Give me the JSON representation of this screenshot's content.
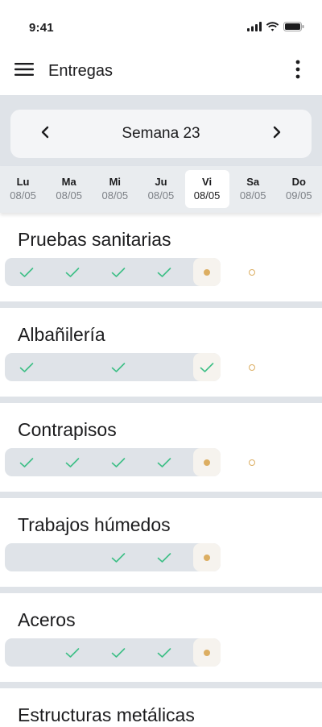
{
  "status": {
    "time": "9:41"
  },
  "appbar": {
    "title": "Entregas"
  },
  "week": {
    "label": "Semana 23"
  },
  "days": [
    {
      "name": "Lu",
      "date": "08/05",
      "active": false
    },
    {
      "name": "Ma",
      "date": "08/05",
      "active": false
    },
    {
      "name": "Mi",
      "date": "08/05",
      "active": false
    },
    {
      "name": "Ju",
      "date": "08/05",
      "active": false
    },
    {
      "name": "Vi",
      "date": "08/05",
      "active": true
    },
    {
      "name": "Sa",
      "date": "08/05",
      "active": false
    },
    {
      "name": "Do",
      "date": "09/05",
      "active": false
    }
  ],
  "sections": [
    {
      "title": "Pruebas sanitarias",
      "checks": [
        true,
        true,
        true,
        true
      ],
      "today": "dot",
      "pending": true
    },
    {
      "title": "Albañilería",
      "checks": [
        true,
        false,
        true,
        false
      ],
      "today": "check",
      "pending": true
    },
    {
      "title": "Contrapisos",
      "checks": [
        true,
        true,
        true,
        true
      ],
      "today": "dot",
      "pending": true
    },
    {
      "title": "Trabajos húmedos",
      "checks": [
        false,
        false,
        true,
        true
      ],
      "today": "dot",
      "pending": false
    },
    {
      "title": "Aceros",
      "checks": [
        false,
        true,
        true,
        true
      ],
      "today": "dot",
      "pending": false
    },
    {
      "title": "Estructuras metálicas",
      "checks": [],
      "today": "",
      "pending": false
    }
  ],
  "colors": {
    "check": "#3dbf86",
    "today_dot": "#dcae62",
    "track": "#dfe3e8",
    "background": "#dfe3e8"
  },
  "icons": {
    "menu": "hamburger-icon",
    "more": "more-vertical-icon",
    "prev": "chevron-left-icon",
    "next": "chevron-right-icon",
    "check": "check-icon",
    "signal": "signal-icon",
    "wifi": "wifi-icon",
    "battery": "battery-icon"
  }
}
